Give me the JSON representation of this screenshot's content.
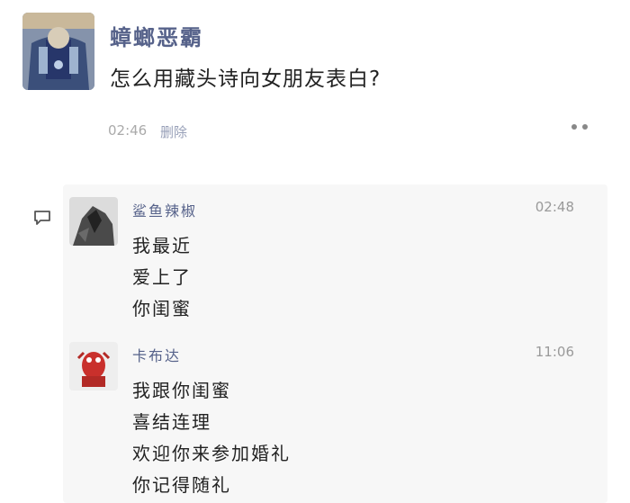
{
  "post": {
    "author": "蟑螂恶霸",
    "content": "怎么用藏头诗向女朋友表白?",
    "time": "02:46",
    "delete_label": "删除"
  },
  "comments": [
    {
      "author": "鲨鱼辣椒",
      "time": "02:48",
      "lines": [
        "我最近",
        "爱上了",
        "你闺蜜"
      ]
    },
    {
      "author": "卡布达",
      "time": "11:06",
      "lines": [
        "我跟你闺蜜",
        "喜结连理",
        "欢迎你来参加婚礼",
        "你记得随礼"
      ]
    }
  ],
  "icons": {
    "more": "more-dots-icon",
    "comment": "comment-bubble-icon"
  },
  "colors": {
    "name_link": "#56628a",
    "panel_bg": "#f7f7f7",
    "timestamp": "#9a9a9a"
  }
}
